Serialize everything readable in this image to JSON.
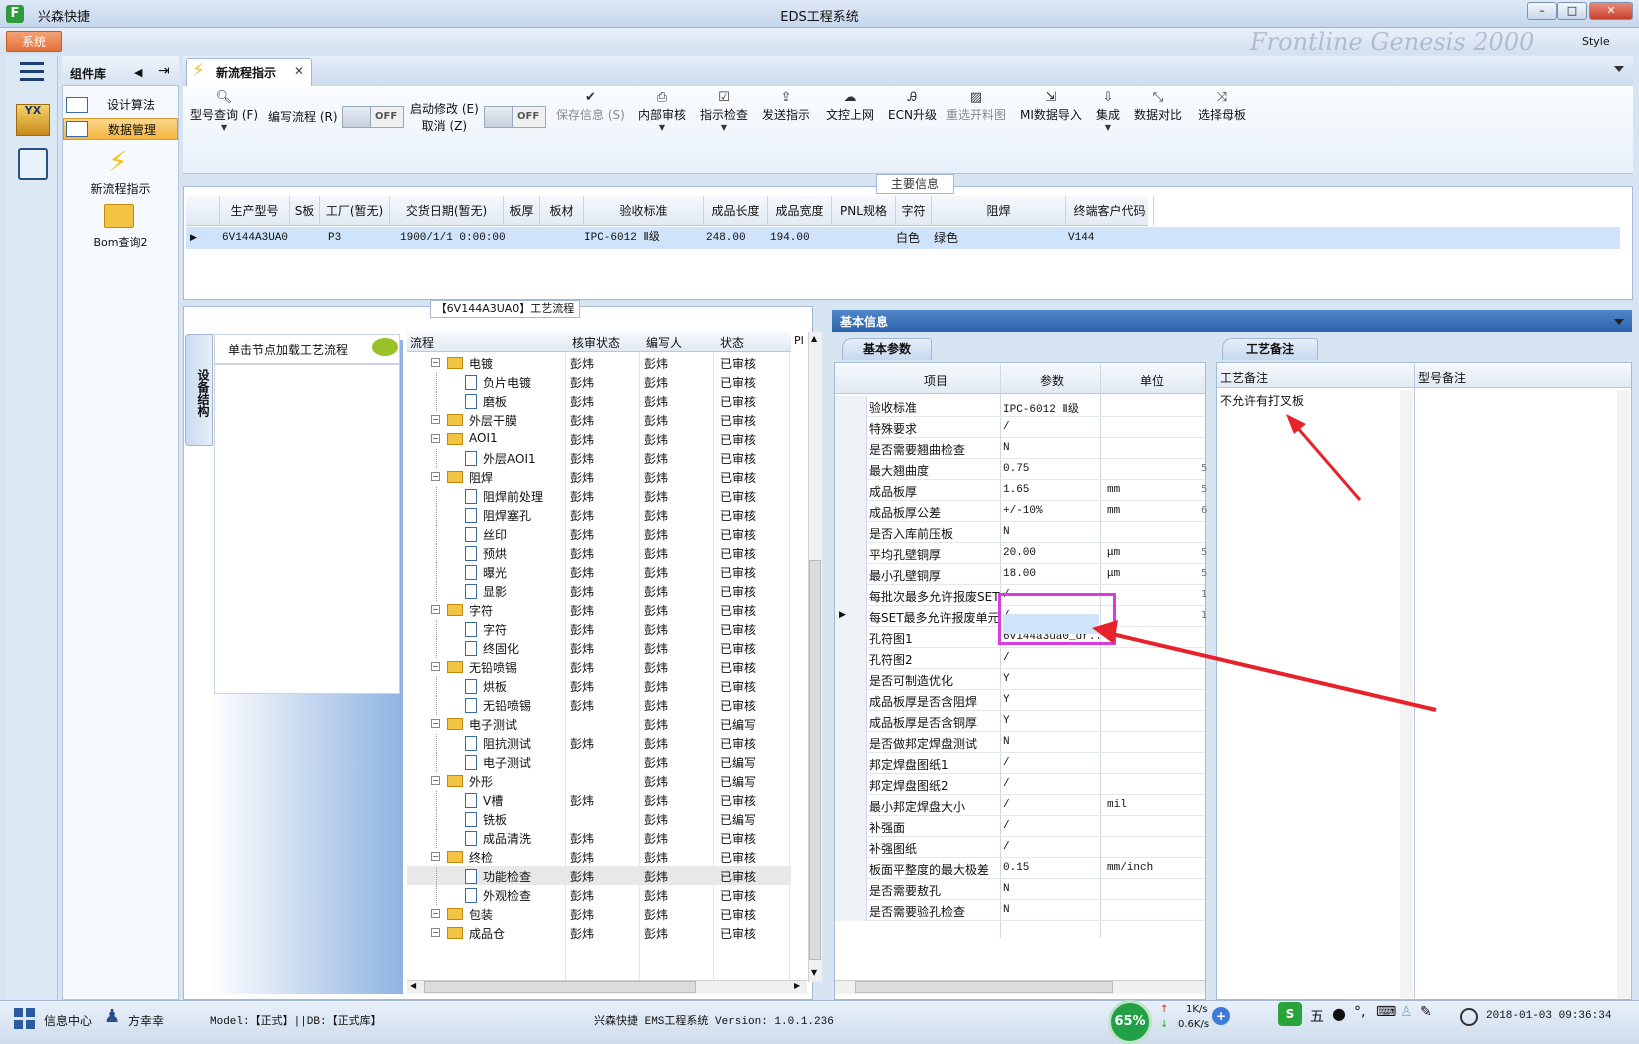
{
  "app": {
    "name": "兴森快捷",
    "window_title": "EDS工程系统",
    "menu_system": "系统",
    "style_label": "Style",
    "banner_text": "Frontline Genesis 2000"
  },
  "component_panel": {
    "title": "组件库",
    "items": [
      "设计算法",
      "数据管理"
    ],
    "big_items": [
      "新流程指示",
      "Bom查询2"
    ]
  },
  "tab": {
    "label": "新流程指示"
  },
  "toolbar": {
    "model_query": "型号查询 (F)",
    "edit_flow": "编写流程 (R)",
    "toggle_off": "OFF",
    "start_modify": "启动修改 (E)",
    "cancel": "取消 (Z)",
    "save_info": "保存信息 (S)",
    "internal_review": "内部审核",
    "check": "指示检查",
    "send": "发送指示",
    "upload": "文控上网",
    "ecn": "ECN升级",
    "reselect": "重选开料图",
    "mi_import": "MI数据导入",
    "integrate": "集成",
    "compare": "数据对比",
    "select_board": "选择母板"
  },
  "main_info": {
    "title": "主要信息",
    "columns": [
      "生产型号",
      "S板",
      "工厂(暂无)",
      "交货日期(暂无)",
      "板厚",
      "板材",
      "验收标准",
      "成品长度",
      "成品宽度",
      "PNL规格",
      "字符",
      "阻焊",
      "终端客户代码"
    ],
    "row": [
      "6V144A3UA0",
      "P3",
      "",
      "1900/1/1 0:00:00",
      "",
      "",
      "IPC-6012 Ⅱ级",
      "248.00",
      "194.00",
      "",
      "白色",
      "绿色",
      "V144"
    ]
  },
  "process": {
    "title": "【6V144A3UA0】工艺流程",
    "side_tab": "设备结构",
    "hint": "单击节点加载工艺流程",
    "columns": [
      "流程",
      "核审状态",
      "编写人",
      "状态",
      "PI"
    ],
    "rows": [
      {
        "name": "电镀",
        "level": 0,
        "reviewer": "彭炜",
        "writer": "彭炜",
        "status": "已审核"
      },
      {
        "name": "负片电镀",
        "level": 1,
        "reviewer": "彭炜",
        "writer": "彭炜",
        "status": "已审核"
      },
      {
        "name": "磨板",
        "level": 1,
        "reviewer": "彭炜",
        "writer": "彭炜",
        "status": "已审核"
      },
      {
        "name": "外层干膜",
        "level": 0,
        "reviewer": "彭炜",
        "writer": "彭炜",
        "status": "已审核"
      },
      {
        "name": "AOI1",
        "level": 0,
        "reviewer": "彭炜",
        "writer": "彭炜",
        "status": "已审核"
      },
      {
        "name": "外层AOI1",
        "level": 1,
        "reviewer": "彭炜",
        "writer": "彭炜",
        "status": "已审核"
      },
      {
        "name": "阻焊",
        "level": 0,
        "reviewer": "彭炜",
        "writer": "彭炜",
        "status": "已审核"
      },
      {
        "name": "阻焊前处理",
        "level": 1,
        "reviewer": "彭炜",
        "writer": "彭炜",
        "status": "已审核"
      },
      {
        "name": "阻焊塞孔",
        "level": 1,
        "reviewer": "彭炜",
        "writer": "彭炜",
        "status": "已审核"
      },
      {
        "name": "丝印",
        "level": 1,
        "reviewer": "彭炜",
        "writer": "彭炜",
        "status": "已审核"
      },
      {
        "name": "预烘",
        "level": 1,
        "reviewer": "彭炜",
        "writer": "彭炜",
        "status": "已审核"
      },
      {
        "name": "曝光",
        "level": 1,
        "reviewer": "彭炜",
        "writer": "彭炜",
        "status": "已审核"
      },
      {
        "name": "显影",
        "level": 1,
        "reviewer": "彭炜",
        "writer": "彭炜",
        "status": "已审核"
      },
      {
        "name": "字符",
        "level": 0,
        "reviewer": "彭炜",
        "writer": "彭炜",
        "status": "已审核"
      },
      {
        "name": "字符",
        "level": 1,
        "reviewer": "彭炜",
        "writer": "彭炜",
        "status": "已审核"
      },
      {
        "name": "终固化",
        "level": 1,
        "reviewer": "彭炜",
        "writer": "彭炜",
        "status": "已审核"
      },
      {
        "name": "无铅喷锡",
        "level": 0,
        "reviewer": "彭炜",
        "writer": "彭炜",
        "status": "已审核"
      },
      {
        "name": "烘板",
        "level": 1,
        "reviewer": "彭炜",
        "writer": "彭炜",
        "status": "已审核"
      },
      {
        "name": "无铅喷锡",
        "level": 1,
        "reviewer": "彭炜",
        "writer": "彭炜",
        "status": "已审核"
      },
      {
        "name": "电子测试",
        "level": 0,
        "reviewer": "",
        "writer": "彭炜",
        "status": "已编写"
      },
      {
        "name": "阻抗测试",
        "level": 1,
        "reviewer": "彭炜",
        "writer": "彭炜",
        "status": "已审核"
      },
      {
        "name": "电子测试",
        "level": 1,
        "reviewer": "",
        "writer": "彭炜",
        "status": "已编写"
      },
      {
        "name": "外形",
        "level": 0,
        "reviewer": "",
        "writer": "彭炜",
        "status": "已编写"
      },
      {
        "name": "V槽",
        "level": 1,
        "reviewer": "彭炜",
        "writer": "彭炜",
        "status": "已审核"
      },
      {
        "name": "铣板",
        "level": 1,
        "reviewer": "",
        "writer": "彭炜",
        "status": "已编写"
      },
      {
        "name": "成品清洗",
        "level": 1,
        "reviewer": "彭炜",
        "writer": "彭炜",
        "status": "已审核"
      },
      {
        "name": "终检",
        "level": 0,
        "reviewer": "彭炜",
        "writer": "彭炜",
        "status": "已审核"
      },
      {
        "name": "功能检查",
        "level": 1,
        "reviewer": "彭炜",
        "writer": "彭炜",
        "status": "已审核"
      },
      {
        "name": "外观检查",
        "level": 1,
        "reviewer": "彭炜",
        "writer": "彭炜",
        "status": "已审核"
      },
      {
        "name": "包装",
        "level": 0,
        "reviewer": "彭炜",
        "writer": "彭炜",
        "status": "已审核"
      },
      {
        "name": "成品仓",
        "level": 0,
        "reviewer": "彭炜",
        "writer": "彭炜",
        "status": "已审核"
      }
    ]
  },
  "basic_info": {
    "title": "基本信息",
    "tab": "基本参数",
    "columns": [
      "项目",
      "参数",
      "单位"
    ],
    "rows": [
      {
        "item": "验收标准",
        "value": "IPC-6012 Ⅱ级",
        "unit": "",
        "extra": ""
      },
      {
        "item": "特殊要求",
        "value": "/",
        "unit": "",
        "extra": ""
      },
      {
        "item": "是否需要翘曲检查",
        "value": "N",
        "unit": "",
        "extra": ""
      },
      {
        "item": "最大翘曲度",
        "value": "0.75",
        "unit": "",
        "extra": "5"
      },
      {
        "item": "成品板厚",
        "value": "1.65",
        "unit": "mm",
        "extra": "5"
      },
      {
        "item": "成品板厚公差",
        "value": "+/-10%",
        "unit": "mm",
        "extra": "6"
      },
      {
        "item": "是否入库前压板",
        "value": "N",
        "unit": "",
        "extra": ""
      },
      {
        "item": "平均孔壁铜厚",
        "value": "20.00",
        "unit": "μm",
        "extra": "5"
      },
      {
        "item": "最小孔壁铜厚",
        "value": "18.00",
        "unit": "μm",
        "extra": "5"
      },
      {
        "item": "每批次最多允许报废SET",
        "value": "/",
        "unit": "",
        "extra": "1"
      },
      {
        "item": "每SET最多允许报废单元",
        "value": "/",
        "unit": "",
        "extra": "1"
      },
      {
        "item": "孔符图1",
        "value": "6v144a3ua0_dr...",
        "unit": "",
        "extra": ""
      },
      {
        "item": "孔符图2",
        "value": "/",
        "unit": "",
        "extra": ""
      },
      {
        "item": "是否可制造优化",
        "value": "Y",
        "unit": "",
        "extra": ""
      },
      {
        "item": "成品板厚是否含阻焊",
        "value": "Y",
        "unit": "",
        "extra": ""
      },
      {
        "item": "成品板厚是否含铜厚",
        "value": "Y",
        "unit": "",
        "extra": ""
      },
      {
        "item": "是否做邦定焊盘测试",
        "value": "N",
        "unit": "",
        "extra": ""
      },
      {
        "item": "邦定焊盘图纸1",
        "value": "/",
        "unit": "",
        "extra": ""
      },
      {
        "item": "邦定焊盘图纸2",
        "value": "/",
        "unit": "",
        "extra": ""
      },
      {
        "item": "最小邦定焊盘大小",
        "value": "/",
        "unit": "mil",
        "extra": ""
      },
      {
        "item": "补强面",
        "value": "/",
        "unit": "",
        "extra": ""
      },
      {
        "item": "补强图纸",
        "value": "/",
        "unit": "",
        "extra": ""
      },
      {
        "item": "板面平整度的最大极差",
        "value": "0.15",
        "unit": "mm/inch",
        "extra": ""
      },
      {
        "item": "是否需要敖孔",
        "value": "N",
        "unit": "",
        "extra": ""
      },
      {
        "item": "是否需要验孔检查",
        "value": "N",
        "unit": "",
        "extra": ""
      }
    ]
  },
  "remarks": {
    "tab": "工艺备注",
    "col1": "工艺备注",
    "col2": "型号备注",
    "text": "不允许有打叉板"
  },
  "status": {
    "info_center": "信息中心",
    "user": "方幸幸",
    "model_db": "Model:【正式】||DB:【正式库】",
    "version": "兴森快捷 EMS工程系统 Version: 1.0.1.236",
    "cpu": "65%",
    "net_up": "1K/s",
    "net_down": "0.6K/s",
    "ime_label": "S",
    "ime_mode": "五",
    "datetime": "2018-01-03 09:36:34"
  },
  "colors": {
    "accent": "#2e63ab",
    "highlight_box": "#d83be0",
    "annotation_arrow": "#e8222a"
  }
}
